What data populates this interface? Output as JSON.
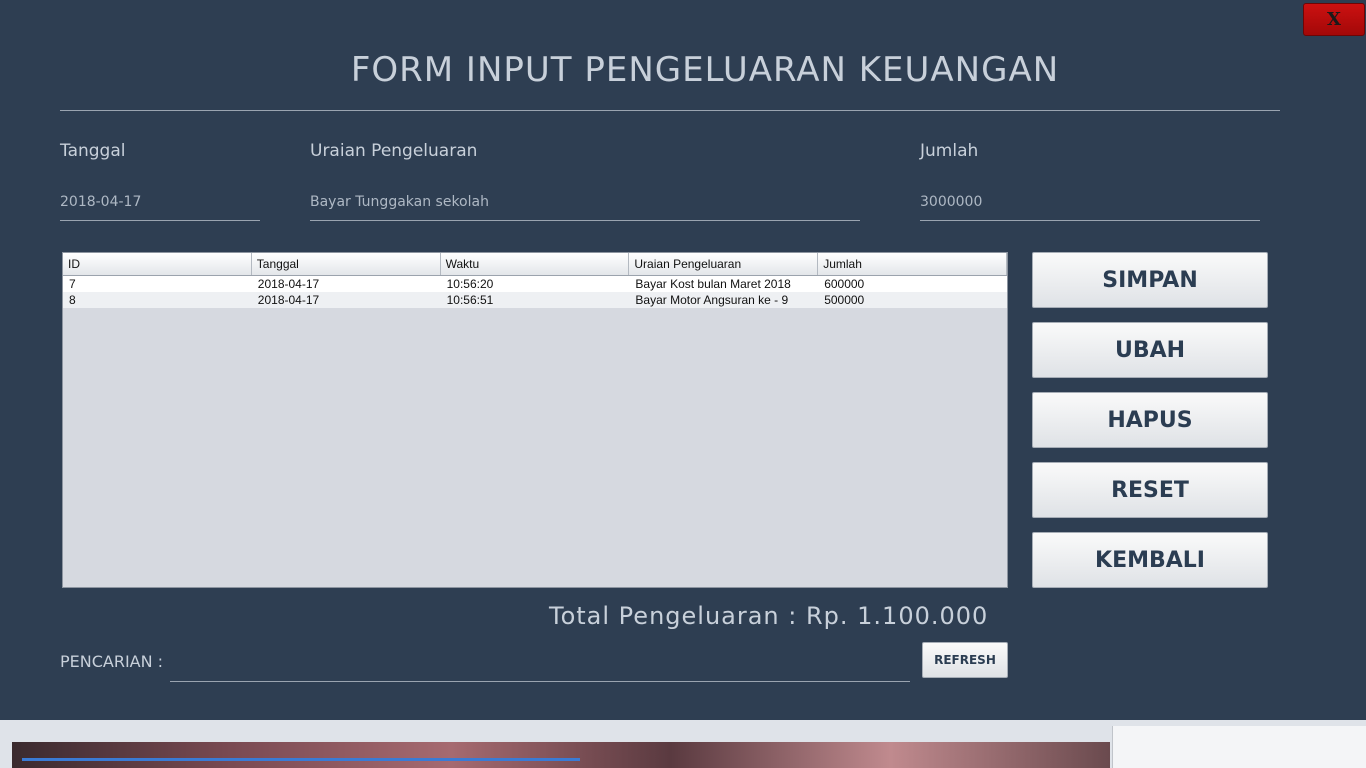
{
  "window": {
    "title": "FORM INPUT PENGELUARAN KEUANGAN",
    "close_label": "X"
  },
  "form": {
    "tanggal_label": "Tanggal",
    "tanggal_value": "2018-04-17",
    "uraian_label": "Uraian Pengeluaran",
    "uraian_value": "Bayar Tunggakan sekolah",
    "jumlah_label": "Jumlah",
    "jumlah_value": "3000000"
  },
  "table": {
    "columns": [
      "ID",
      "Tanggal",
      "Waktu",
      "Uraian Pengeluaran",
      "Jumlah"
    ],
    "rows": [
      [
        "7",
        "2018-04-17",
        "10:56:20",
        "Bayar Kost bulan Maret 2018",
        "600000"
      ],
      [
        "8",
        "2018-04-17",
        "10:56:51",
        "Bayar Motor Angsuran ke - 9",
        "500000"
      ]
    ]
  },
  "buttons": {
    "simpan": "SIMPAN",
    "ubah": "UBAH",
    "hapus": "HAPUS",
    "reset": "RESET",
    "kembali": "KEMBALI"
  },
  "total": {
    "text": "Total Pengeluaran  :  Rp. 1.100.000"
  },
  "search": {
    "label": "PENCARIAN :",
    "value": "",
    "refresh_label": "REFRESH"
  },
  "colors": {
    "background": "#2e3e52",
    "close_button": "#c41010",
    "button_text": "#2b3d52"
  }
}
